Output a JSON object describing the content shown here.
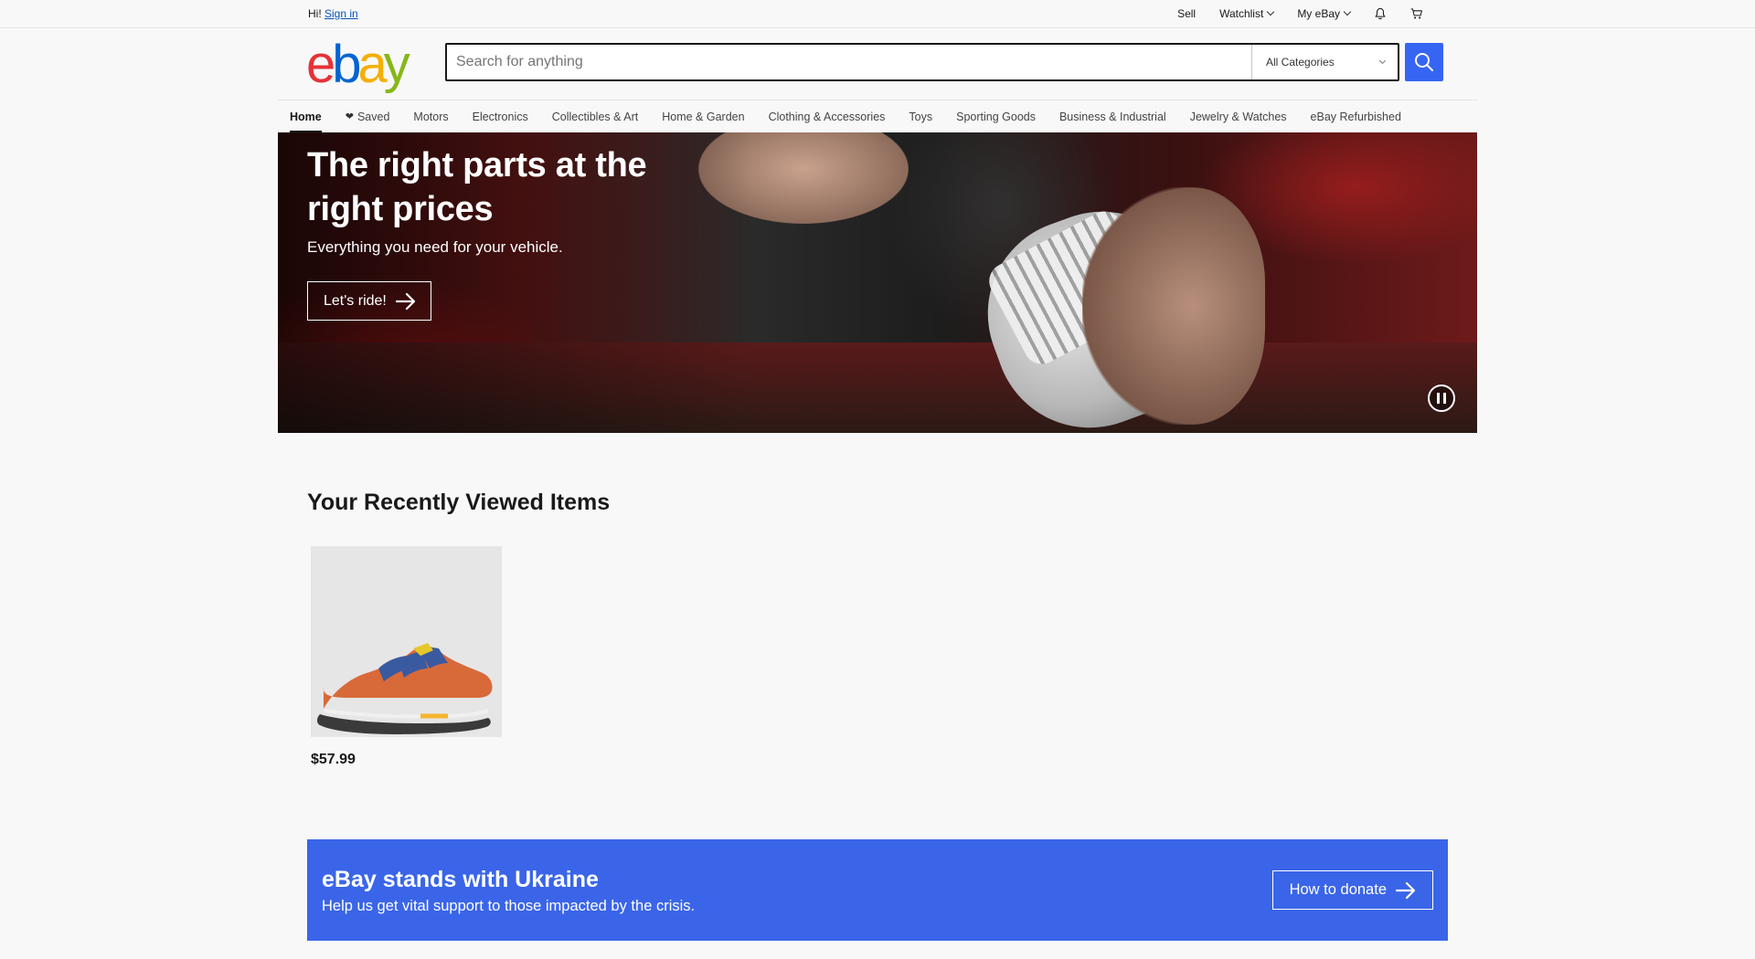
{
  "topbar": {
    "greeting": "Hi!",
    "signin": "Sign in",
    "sell": "Sell",
    "watchlist": "Watchlist",
    "myebay": "My eBay"
  },
  "logo": {
    "e": "e",
    "b": "b",
    "a": "a",
    "y": "y"
  },
  "search": {
    "placeholder": "Search for anything",
    "category": "All Categories"
  },
  "nav": {
    "items": [
      "Home",
      "Saved",
      "Motors",
      "Electronics",
      "Collectibles & Art",
      "Home & Garden",
      "Clothing & Accessories",
      "Toys",
      "Sporting Goods",
      "Business & Industrial",
      "Jewelry & Watches",
      "eBay Refurbished"
    ]
  },
  "hero": {
    "title": "The right parts at the right prices",
    "subtitle": "Everything you need for your vehicle.",
    "cta": "Let's ride!"
  },
  "recent": {
    "title": "Your Recently Viewed Items",
    "items": [
      {
        "price": "$57.99"
      }
    ]
  },
  "banner": {
    "title": "eBay stands with Ukraine",
    "subtitle": "Help us get vital support to those impacted by the crisis.",
    "cta": "How to donate"
  },
  "colors": {
    "accent": "#3665f3",
    "banner": "#3a65e8",
    "link": "#0654ba"
  }
}
